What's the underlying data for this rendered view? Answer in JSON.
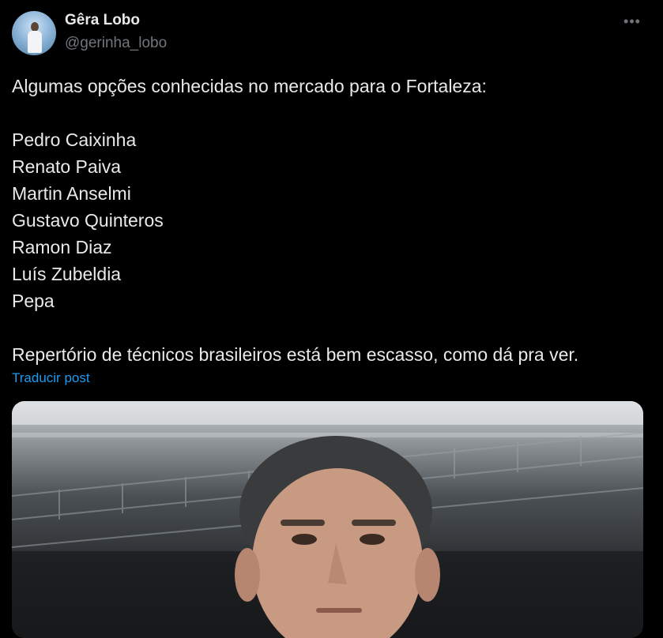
{
  "author": {
    "display_name": "Gêra Lobo",
    "handle": "@gerinha_lobo",
    "avatar_icon": "profile-photo"
  },
  "more_icon": "ellipsis-icon",
  "tweet": {
    "intro": "Algumas opções conhecidas no mercado para o Fortaleza:",
    "names": [
      "Pedro Caixinha",
      "Renato Paiva",
      "Martin Anselmi",
      "Gustavo Quinteros",
      "Ramon Diaz",
      "Luís Zubeldia",
      "Pepa"
    ],
    "closing": "Repertório de técnicos brasileiros está bem escasso, como dá pra ver."
  },
  "translate_label": "Traducir post",
  "colors": {
    "background": "#000000",
    "text": "#e7e9ea",
    "muted": "#71767b",
    "link": "#1d9bf0"
  },
  "media": {
    "description_icon": "photo-icon"
  }
}
